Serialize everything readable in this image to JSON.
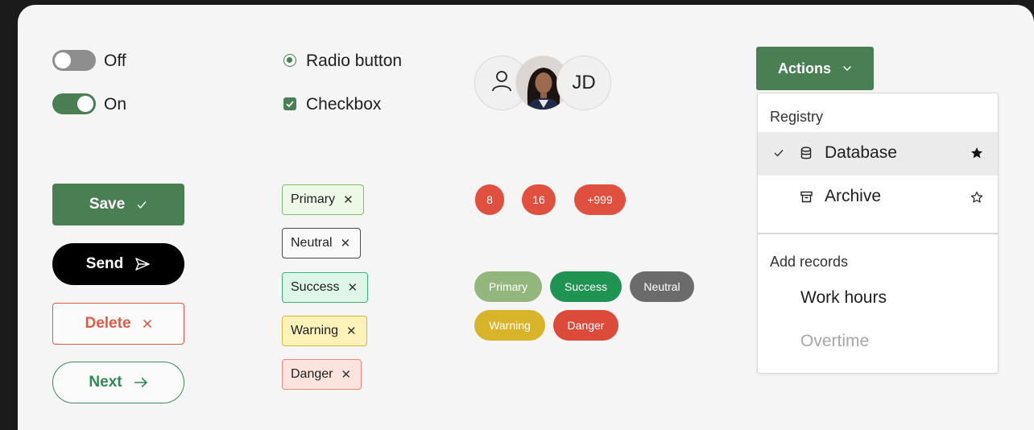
{
  "toggles": [
    {
      "label": "Off",
      "state": "off"
    },
    {
      "label": "On",
      "state": "on"
    }
  ],
  "selection_controls": {
    "radio_label": "Radio button",
    "checkbox_label": "Checkbox"
  },
  "avatars": [
    {
      "type": "icon",
      "icon": "user-icon"
    },
    {
      "type": "photo"
    },
    {
      "type": "initials",
      "text": "JD"
    }
  ],
  "buttons": {
    "save": {
      "label": "Save",
      "icon": "check-icon"
    },
    "send": {
      "label": "Send",
      "icon": "send-icon"
    },
    "delete": {
      "label": "Delete",
      "icon": "close-icon"
    },
    "next": {
      "label": "Next",
      "icon": "arrow-right-icon"
    }
  },
  "tags": [
    {
      "label": "Primary",
      "variant": "primary"
    },
    {
      "label": "Neutral",
      "variant": "neutral"
    },
    {
      "label": "Success",
      "variant": "success"
    },
    {
      "label": "Warning",
      "variant": "warning"
    },
    {
      "label": "Danger",
      "variant": "danger"
    }
  ],
  "tag_close_glyph": "✕",
  "count_badges": [
    "8",
    "16",
    "+999"
  ],
  "status_pills": [
    {
      "label": "Primary",
      "color": "#93b67c"
    },
    {
      "label": "Success",
      "color": "#1f9452"
    },
    {
      "label": "Neutral",
      "color": "#6b6b6b"
    },
    {
      "label": "Warning",
      "color": "#d8b42a"
    },
    {
      "label": "Danger",
      "color": "#dc4a3a"
    }
  ],
  "dropdown": {
    "button_label": "Actions",
    "groups": [
      {
        "title": "Registry",
        "items": [
          {
            "label": "Database",
            "selected": true,
            "icon": "database-icon",
            "favorite": true
          },
          {
            "label": "Archive",
            "selected": false,
            "icon": "archive-icon",
            "favorite": false
          }
        ]
      },
      {
        "title": "Add records",
        "items": [
          {
            "label": "Work hours",
            "disabled": false
          },
          {
            "label": "Overtime",
            "disabled": true
          }
        ]
      }
    ]
  },
  "colors": {
    "accent_green": "#4a7f53",
    "danger_red": "#e05a45",
    "success_green": "#2e8a55",
    "badge_red": "#e0503f",
    "background": "#f5f5f5"
  }
}
